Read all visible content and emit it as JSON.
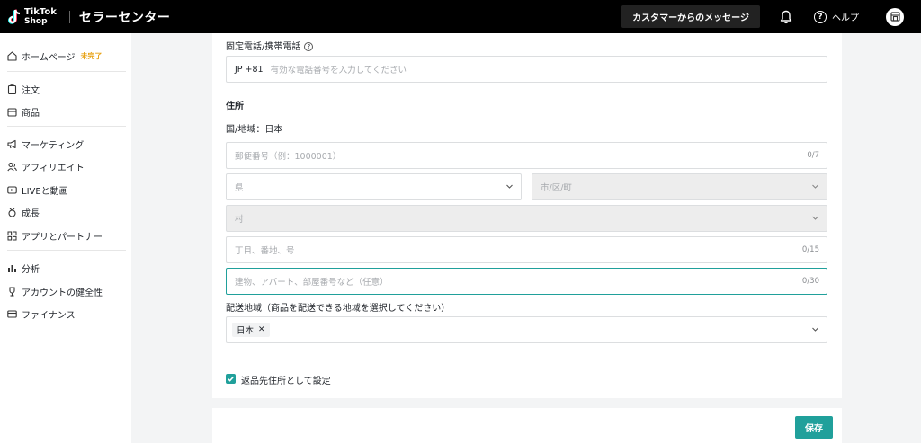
{
  "header": {
    "logo_line1": "TikTok",
    "logo_line2": "Shop",
    "title": "セラーセンター",
    "message_button": "カスタマーからのメッセージ",
    "help_label": "ヘルプ"
  },
  "sidebar": {
    "items": [
      {
        "label": "ホームページ",
        "badge": "未完了",
        "icon": "home-icon"
      },
      {
        "label": "注文",
        "icon": "clipboard-icon"
      },
      {
        "label": "商品",
        "icon": "box-icon"
      },
      {
        "label": "マーケティング",
        "icon": "megaphone-icon"
      },
      {
        "label": "アフィリエイト",
        "icon": "people-icon"
      },
      {
        "label": "LIVEと動画",
        "icon": "live-icon"
      },
      {
        "label": "成長",
        "icon": "medal-icon"
      },
      {
        "label": "アプリとパートナー",
        "icon": "grid-icon"
      },
      {
        "label": "分析",
        "icon": "chart-icon"
      },
      {
        "label": "アカウントの健全性",
        "icon": "trophy-icon"
      },
      {
        "label": "ファイナンス",
        "icon": "card-icon"
      }
    ]
  },
  "form": {
    "phone_label": "固定電話/携帯電話",
    "phone_prefix": "JP +81",
    "phone_placeholder": "有効な電話番号を入力してください",
    "address_heading": "住所",
    "country_label": "国/地域：日本",
    "postal_placeholder": "郵便番号（例：1000001）",
    "postal_counter": "0/7",
    "prefecture_placeholder": "県",
    "city_placeholder": "市/区/町",
    "village_placeholder": "村",
    "street_placeholder": "丁目、番地、号",
    "street_counter": "0/15",
    "building_placeholder": "建物、アパート、部屋番号など（任意）",
    "building_counter": "0/30",
    "delivery_label": "配送地域（商品を配送できる地域を選択してください）",
    "delivery_tag": "日本",
    "return_checkbox_label": "返品先住所として設定",
    "return_checked": true,
    "save_button": "保存"
  },
  "colors": {
    "accent": "#20a09b",
    "badge": "#e8a317"
  }
}
